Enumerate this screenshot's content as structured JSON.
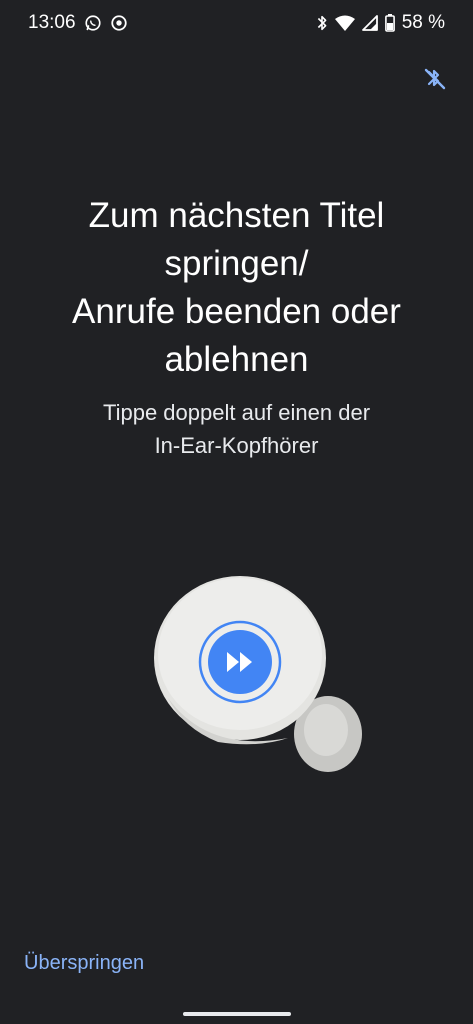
{
  "status_bar": {
    "time": "13:06",
    "left_icons": [
      "whatsapp-icon",
      "focus-mode-icon"
    ],
    "right_icons": [
      "bluetooth-icon",
      "wifi-icon",
      "cellular-signal-icon",
      "battery-icon"
    ],
    "battery_percent": "58 %"
  },
  "header": {
    "action_icon": "bluetooth-disabled-icon"
  },
  "main": {
    "title": "Zum nächsten Titel\nspringen/\nAnrufe beenden oder\nablehnen",
    "subtitle": "Tippe doppelt auf einen der\nIn-Ear-Kopfhörer",
    "illustration_icon": "fast-forward-icon"
  },
  "footer": {
    "skip_label": "Überspringen"
  },
  "colors": {
    "background": "#202124",
    "accent": "#8ab4f8",
    "earbud_blue": "#4285f4",
    "earbud_body": "#d9d9d6"
  }
}
